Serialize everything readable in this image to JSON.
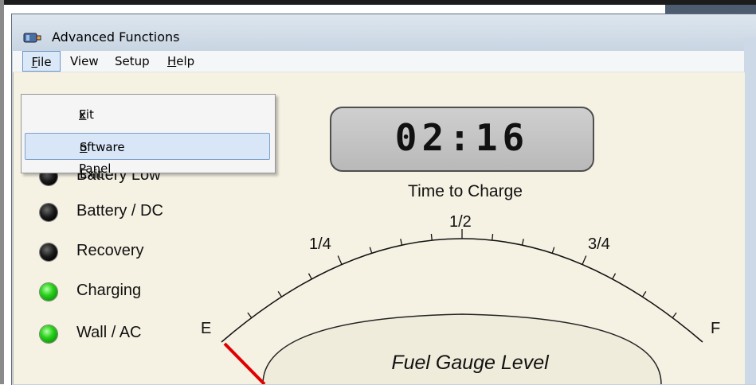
{
  "window": {
    "title": "Advanced Functions"
  },
  "menubar": {
    "file": "File",
    "file_u": "F",
    "file_rest": "ile",
    "view": "View",
    "setup": "Setup",
    "help": "Help",
    "help_u": "H",
    "help_rest": "elp"
  },
  "file_menu": {
    "exit_panel_u": "E",
    "exit_panel_rest": "xit Advanced Panel",
    "software_exit_u": "S",
    "software_exit_rest": "oftware Exit",
    "highlighted": "Software Exit"
  },
  "indicators": [
    {
      "label": "Battery Low",
      "state": "off"
    },
    {
      "label": "Battery / DC",
      "state": "off"
    },
    {
      "label": "Recovery",
      "state": "off"
    },
    {
      "label": "Charging",
      "state": "on"
    },
    {
      "label": "Wall / AC",
      "state": "on"
    }
  ],
  "timer": {
    "value": "02:16",
    "label": "Time to Charge"
  },
  "gauge": {
    "title": "Fuel Gauge Level",
    "marks": {
      "empty": "E",
      "quarter": "1/4",
      "half": "1/2",
      "three_quarter": "3/4",
      "full": "F"
    }
  },
  "colors": {
    "panel_bg": "#f5f1e3",
    "led_on": "#28d21a",
    "led_off": "#1c1c1c",
    "needle": "#e00000",
    "menu_highlight": "#d8e6f8"
  }
}
